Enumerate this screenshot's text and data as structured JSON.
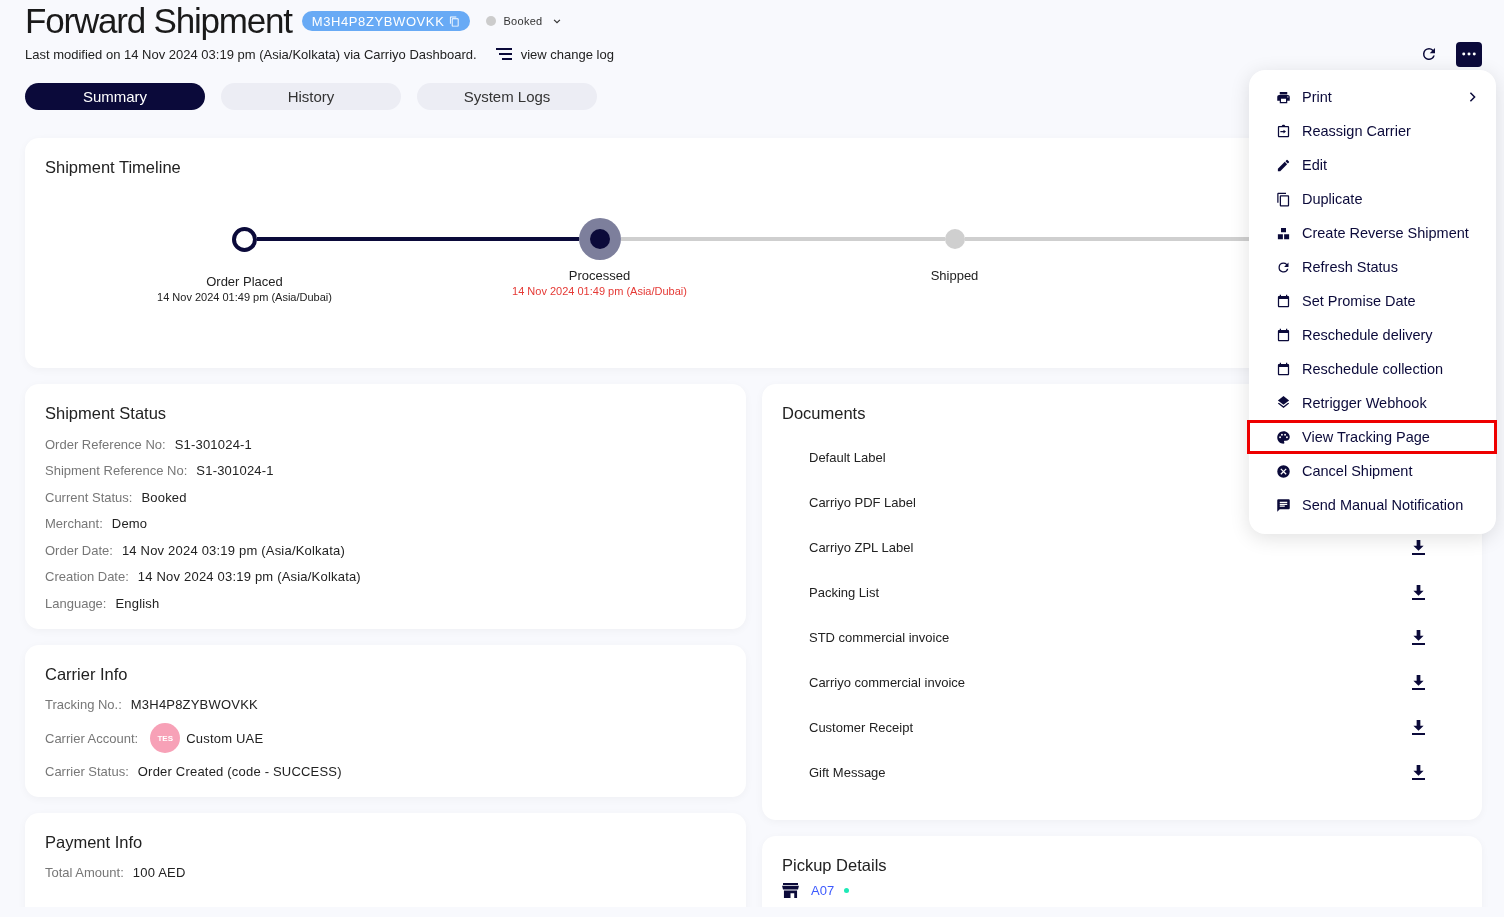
{
  "header": {
    "title": "Forward Shipment",
    "tracking_badge": "M3H4P8ZYBWOVKK",
    "status": "Booked",
    "last_modified": "Last modified on 14 Nov 2024 03:19 pm (Asia/Kolkata) via Carriyo Dashboard.",
    "change_log_link": "view change log"
  },
  "tabs": [
    {
      "label": "Summary",
      "selected": true
    },
    {
      "label": "History",
      "selected": false
    },
    {
      "label": "System Logs",
      "selected": false
    }
  ],
  "timeline": {
    "title": "Shipment Timeline",
    "steps": [
      {
        "label": "Order Placed",
        "date": "14 Nov 2024 01:49 pm (Asia/Dubai)",
        "completed": true,
        "current": false
      },
      {
        "label": "Processed",
        "date": "14 Nov 2024 01:49 pm (Asia/Dubai)",
        "completed": false,
        "current": true
      },
      {
        "label": "Shipped",
        "completed": false,
        "current": false
      }
    ]
  },
  "shipment_status": {
    "title": "Shipment Status",
    "fields": [
      {
        "label": "Order Reference No:",
        "value": "S1-301024-1"
      },
      {
        "label": "Shipment Reference No:",
        "value": "S1-301024-1"
      },
      {
        "label": "Current Status:",
        "value": "Booked"
      },
      {
        "label": "Merchant:",
        "value": "Demo"
      },
      {
        "label": "Order Date:",
        "value": "14 Nov 2024 03:19 pm (Asia/Kolkata)"
      },
      {
        "label": "Creation Date:",
        "value": "14 Nov 2024 03:19 pm (Asia/Kolkata)"
      },
      {
        "label": "Language:",
        "value": "English"
      }
    ]
  },
  "carrier_info": {
    "title": "Carrier Info",
    "tracking_label": "Tracking No.:",
    "tracking_value": "M3H4P8ZYBWOVKK",
    "account_label": "Carrier Account:",
    "account_avatar": "TES",
    "account_value": "Custom UAE",
    "status_label": "Carrier Status:",
    "status_value": "Order Created (code - SUCCESS)"
  },
  "payment_info": {
    "title": "Payment Info",
    "fields": [
      {
        "label": "Total Amount:",
        "value": "100 AED"
      }
    ]
  },
  "documents": {
    "title": "Documents",
    "items": [
      "Default Label",
      "Carriyo PDF Label",
      "Carriyo ZPL Label",
      "Packing List",
      "STD commercial invoice",
      "Carriyo commercial invoice",
      "Customer Receipt",
      "Gift Message"
    ]
  },
  "pickup_details": {
    "title": "Pickup Details",
    "location": "A07",
    "active": true
  },
  "actions_menu": {
    "items": [
      {
        "label": "Print",
        "kind": "printer",
        "has_submenu": true,
        "highlighted": false
      },
      {
        "label": "Reassign Carrier",
        "kind": "reassign",
        "has_submenu": false,
        "highlighted": false
      },
      {
        "label": "Edit",
        "kind": "pencil",
        "has_submenu": false,
        "highlighted": false
      },
      {
        "label": "Duplicate",
        "kind": "copy",
        "has_submenu": false,
        "highlighted": false
      },
      {
        "label": "Create Reverse Shipment",
        "kind": "blocks",
        "has_submenu": false,
        "highlighted": false
      },
      {
        "label": "Refresh Status",
        "kind": "refresh",
        "has_submenu": false,
        "highlighted": false
      },
      {
        "label": "Set Promise Date",
        "kind": "calendar",
        "has_submenu": false,
        "highlighted": false
      },
      {
        "label": "Reschedule delivery",
        "kind": "calendar",
        "has_submenu": false,
        "highlighted": false
      },
      {
        "label": "Reschedule collection",
        "kind": "calendar",
        "has_submenu": false,
        "highlighted": false
      },
      {
        "label": "Retrigger Webhook",
        "kind": "layers",
        "has_submenu": false,
        "highlighted": false
      },
      {
        "label": "View Tracking Page",
        "kind": "palette",
        "has_submenu": false,
        "highlighted": true
      },
      {
        "label": "Cancel Shipment",
        "kind": "cancel",
        "has_submenu": false,
        "highlighted": false
      },
      {
        "label": "Send Manual Notification",
        "kind": "message",
        "has_submenu": false,
        "highlighted": false
      }
    ]
  }
}
